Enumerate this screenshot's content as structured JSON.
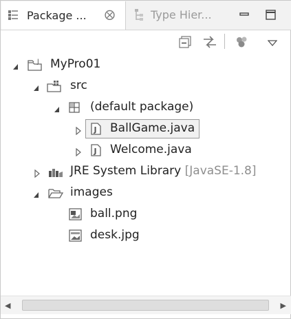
{
  "tabs": {
    "package_explorer": {
      "label": "Package ...",
      "close_glyph": "⨂"
    },
    "type_hierarchy": {
      "label": "Type Hier..."
    }
  },
  "tree": {
    "project": {
      "label": "MyPro01"
    },
    "src": {
      "label": "src"
    },
    "default_package": {
      "label": "(default package)"
    },
    "files": [
      {
        "label": "BallGame.java",
        "selected": true
      },
      {
        "label": "Welcome.java",
        "selected": false
      }
    ],
    "jre": {
      "label": "JRE System Library",
      "decoration": "[JavaSE-1.8]"
    },
    "images_folder": {
      "label": "images"
    },
    "images": [
      {
        "label": "ball.png"
      },
      {
        "label": "desk.jpg"
      }
    ]
  },
  "scrollbar": {
    "left_glyph": "◀",
    "right_glyph": "▶"
  },
  "colors": {
    "selection_bg": "#f1f1f1",
    "muted_text": "#8e8e8e"
  }
}
